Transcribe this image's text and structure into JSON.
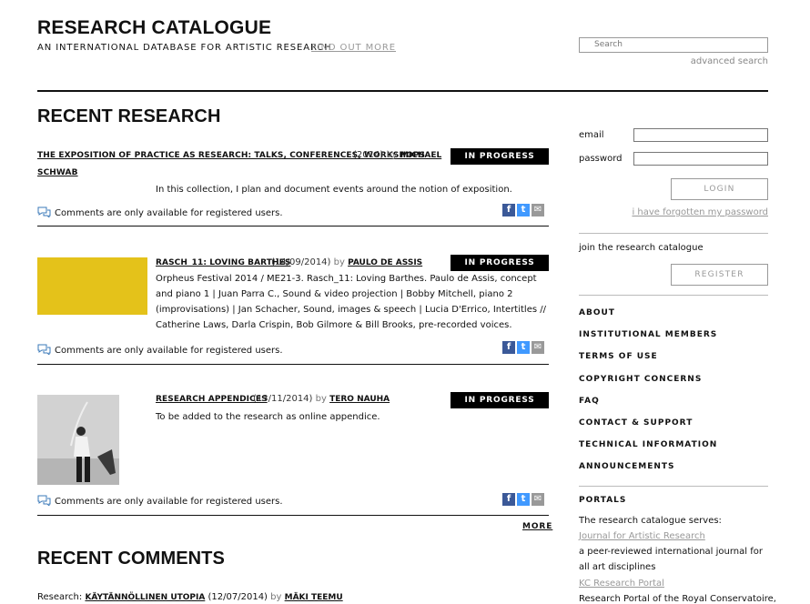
{
  "header": {
    "title": "RESEARCH CATALOGUE",
    "subtitle": "AN INTERNATIONAL DATABASE FOR ARTISTIC RESEARCH",
    "find_more": "FIND OUT MORE",
    "search_placeholder": "Search",
    "advanced_search": "advanced search"
  },
  "recent_research": {
    "title": "RECENT RESEARCH",
    "entries": [
      {
        "title": "THE EXPOSITION OF PRACTICE AS RESEARCH: TALKS, CONFERENCES, WORKSHOPS",
        "date": "(2014)",
        "by": "by",
        "author_first": "MICHAEL",
        "author_second": "SCHWAB",
        "status": "IN PROGRESS",
        "description": "In this collection, I plan and document events around the notion of exposition.",
        "comments": "Comments are only available for registered users."
      },
      {
        "title": "RASCH_11: LOVING BARTHES",
        "date": "(14/09/2014)",
        "by": "by",
        "author": "PAULO DE ASSIS",
        "status": "IN PROGRESS",
        "description": "Orpheus Festival 2014 / ME21-3. Rasch_11: Loving Barthes. Paulo de Assis, concept and piano 1 | Juan Parra C., Sound & video projection | Bobby Mitchell, piano 2 (improvisations) | Jan Schacher, Sound, images & speech | Lucia D'Errico, Intertitles // Catherine Laws, Darla Crispin, Bob Gilmore & Bill Brooks, pre-recorded voices.",
        "comments": "Comments are only available for registered users.",
        "thumb_color": "#e4c21a"
      },
      {
        "title": "RESEARCH APPENDICES",
        "date": "(13/11/2014)",
        "by": "by",
        "author": "TERO NAUHA",
        "status": "IN PROGRESS",
        "description": "To be added to the research as online appendice.",
        "comments": "Comments are only available for registered users."
      }
    ],
    "more": "MORE"
  },
  "recent_comments": {
    "title": "RECENT COMMENTS",
    "first": {
      "prefix": "Research:",
      "link": "KÄYTÄNNÖLLINEN UTOPIA",
      "date": "(12/07/2014)",
      "by": "by",
      "author": "MÄKI TEEMU"
    }
  },
  "login": {
    "email_label": "email",
    "password_label": "password",
    "login_button": "LOGIN",
    "forgot": "i have forgotten my password",
    "join": "join the research catalogue",
    "register_button": "REGISTER"
  },
  "nav": {
    "items": [
      "ABOUT",
      "INSTITUTIONAL MEMBERS",
      "TERMS OF USE",
      "COPYRIGHT CONCERNS",
      "FAQ",
      "CONTACT & SUPPORT",
      "TECHNICAL INFORMATION",
      "ANNOUNCEMENTS"
    ]
  },
  "portals": {
    "title": "PORTALS",
    "intro": "The research catalogue serves:",
    "link1": "Journal for Artistic Research",
    "text1": "a peer-reviewed international journal for all art disciplines",
    "link2": "KC Research Portal",
    "text2": "Research Portal of the Royal Conservatoire,"
  },
  "share_icons": [
    "facebook-icon",
    "twitter-icon",
    "mail-icon"
  ],
  "colors": {
    "badge": "#000000",
    "facebook": "#3b5998",
    "twitter": "#4099ff",
    "mail": "#999999",
    "thumb_yellow": "#e4c21a"
  }
}
